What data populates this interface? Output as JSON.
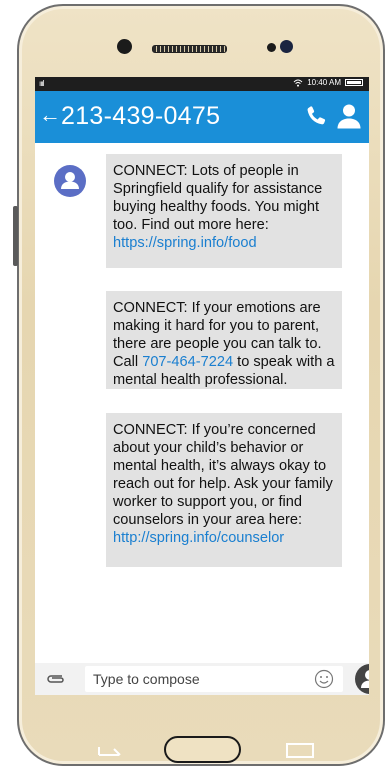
{
  "status_bar": {
    "signal": "ıııl",
    "time": "10:40 AM"
  },
  "header": {
    "back_glyph": "←",
    "phone_number": "213-439-0475"
  },
  "messages": [
    {
      "text": "CONNECT: Lots of people in Springfield qualify for assistance buying healthy foods. You might too. Find out more here:",
      "link": "https://spring.info/food"
    },
    {
      "text_before": "CONNECT: If your emotions are making it hard for you to parent, there are people you can talk to. Call",
      "link": "707-464-7224",
      "text_after": "to speak with a mental health professional."
    },
    {
      "text": "CONNECT: If you’re concerned about your child’s behavior or mental health, it’s always okay to reach out for help. Ask your family worker to support you, or find counselors in your area here:",
      "link": "http://spring.info/counselor"
    }
  ],
  "compose": {
    "placeholder": "Type to compose"
  },
  "colors": {
    "app_bar": "#1a8fd8",
    "link": "#1a7fd0",
    "bubble": "#e2e2e2",
    "avatar": "#5b6ec5"
  }
}
